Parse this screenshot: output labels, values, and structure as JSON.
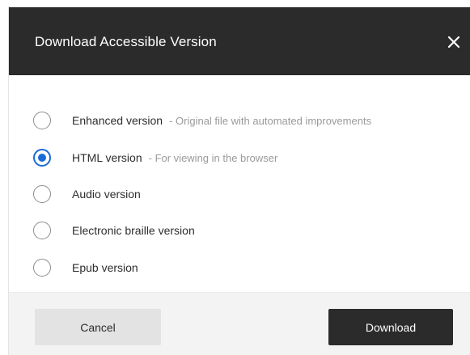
{
  "dialog": {
    "title": "Download Accessible Version",
    "close_icon": "close-icon"
  },
  "options": [
    {
      "label": "Enhanced version",
      "desc": "- Original file with automated improvements",
      "selected": false
    },
    {
      "label": "HTML version",
      "desc": "- For viewing in the browser",
      "selected": true
    },
    {
      "label": "Audio version",
      "desc": "",
      "selected": false
    },
    {
      "label": "Electronic braille version",
      "desc": "",
      "selected": false
    },
    {
      "label": "Epub version",
      "desc": "",
      "selected": false
    }
  ],
  "footer": {
    "cancel_label": "Cancel",
    "download_label": "Download"
  },
  "colors": {
    "header_bg": "#2b2b2b",
    "accent": "#1b6ad8",
    "footer_bg": "#f3f3f3"
  }
}
